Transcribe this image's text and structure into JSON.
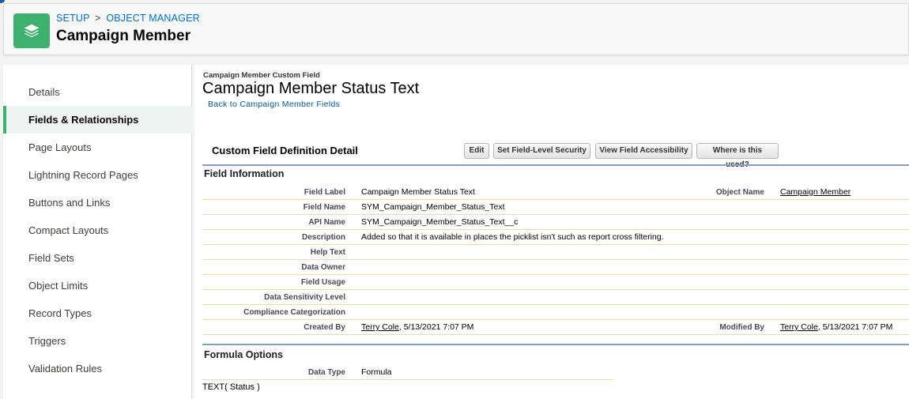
{
  "header": {
    "breadcrumb_setup": "SETUP",
    "breadcrumb_sep": ">",
    "breadcrumb_object_manager": "OBJECT MANAGER",
    "title": "Campaign Member",
    "icon": "layers-icon",
    "accent_color": "#3fb16f"
  },
  "sidebar": {
    "items": [
      {
        "label": "Details"
      },
      {
        "label": "Fields & Relationships",
        "active": true
      },
      {
        "label": "Page Layouts"
      },
      {
        "label": "Lightning Record Pages"
      },
      {
        "label": "Buttons and Links"
      },
      {
        "label": "Compact Layouts"
      },
      {
        "label": "Field Sets"
      },
      {
        "label": "Object Limits"
      },
      {
        "label": "Record Types"
      },
      {
        "label": "Triggers"
      },
      {
        "label": "Validation Rules"
      }
    ]
  },
  "main": {
    "pre_title": "Campaign Member Custom Field",
    "title": "Campaign Member Status Text",
    "back_link": "Back to Campaign Member Fields",
    "detail_title": "Custom Field Definition Detail",
    "buttons": {
      "edit": "Edit",
      "set_fls": "Set Field-Level Security",
      "view_access": "View Field Accessibility",
      "where_used": "Where is this used?"
    },
    "field_info_title": "Field Information",
    "fields": {
      "field_label": {
        "label": "Field Label",
        "value": "Campaign Member Status Text"
      },
      "object_name": {
        "label": "Object Name",
        "value": "Campaign Member"
      },
      "field_name": {
        "label": "Field Name",
        "value": "SYM_Campaign_Member_Status_Text"
      },
      "api_name": {
        "label": "API Name",
        "value": "SYM_Campaign_Member_Status_Text__c"
      },
      "description": {
        "label": "Description",
        "value": "Added so that it is available in places the picklist isn't such as report cross filtering."
      },
      "help_text": {
        "label": "Help Text",
        "value": ""
      },
      "data_owner": {
        "label": "Data Owner",
        "value": ""
      },
      "field_usage": {
        "label": "Field Usage",
        "value": ""
      },
      "data_sensitivity": {
        "label": "Data Sensitivity Level",
        "value": ""
      },
      "compliance": {
        "label": "Compliance Categorization",
        "value": ""
      },
      "created_by": {
        "label": "Created By",
        "user": "Terry Cole",
        "date": ", 5/13/2021 7:07 PM"
      },
      "modified_by": {
        "label": "Modified By",
        "user": "Terry Cole",
        "date": ", 5/13/2021 7:07 PM"
      }
    },
    "formula_options_title": "Formula Options",
    "data_type": {
      "label": "Data Type",
      "value": "Formula"
    },
    "formula": "TEXT( Status )"
  }
}
